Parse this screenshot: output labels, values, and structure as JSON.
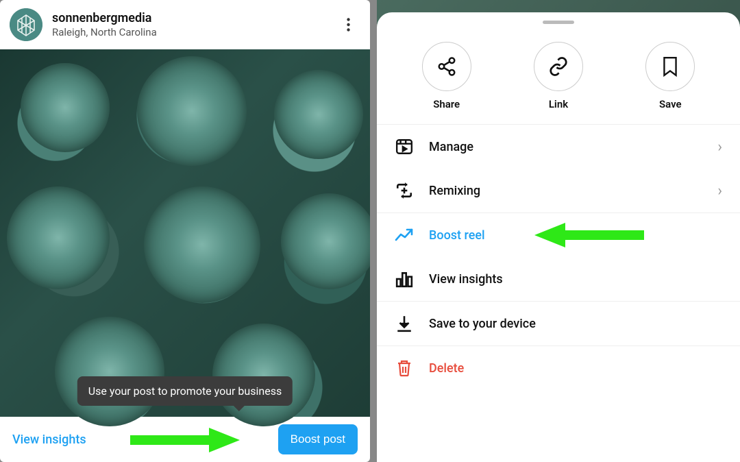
{
  "left": {
    "username": "sonnenbergmedia",
    "location": "Raleigh, North Carolina",
    "tooltip": "Use your post to promote your business",
    "view_insights": "View insights",
    "boost_post": "Boost post"
  },
  "right": {
    "actions": {
      "share": "Share",
      "link": "Link",
      "save": "Save"
    },
    "menu": {
      "manage": "Manage",
      "remixing": "Remixing",
      "boost_reel": "Boost reel",
      "view_insights": "View insights",
      "save_device": "Save to your device",
      "delete": "Delete"
    }
  },
  "colors": {
    "accent_blue": "#1ea1f2",
    "accent_red": "#e74c3c",
    "arrow_green": "#2ee817"
  }
}
